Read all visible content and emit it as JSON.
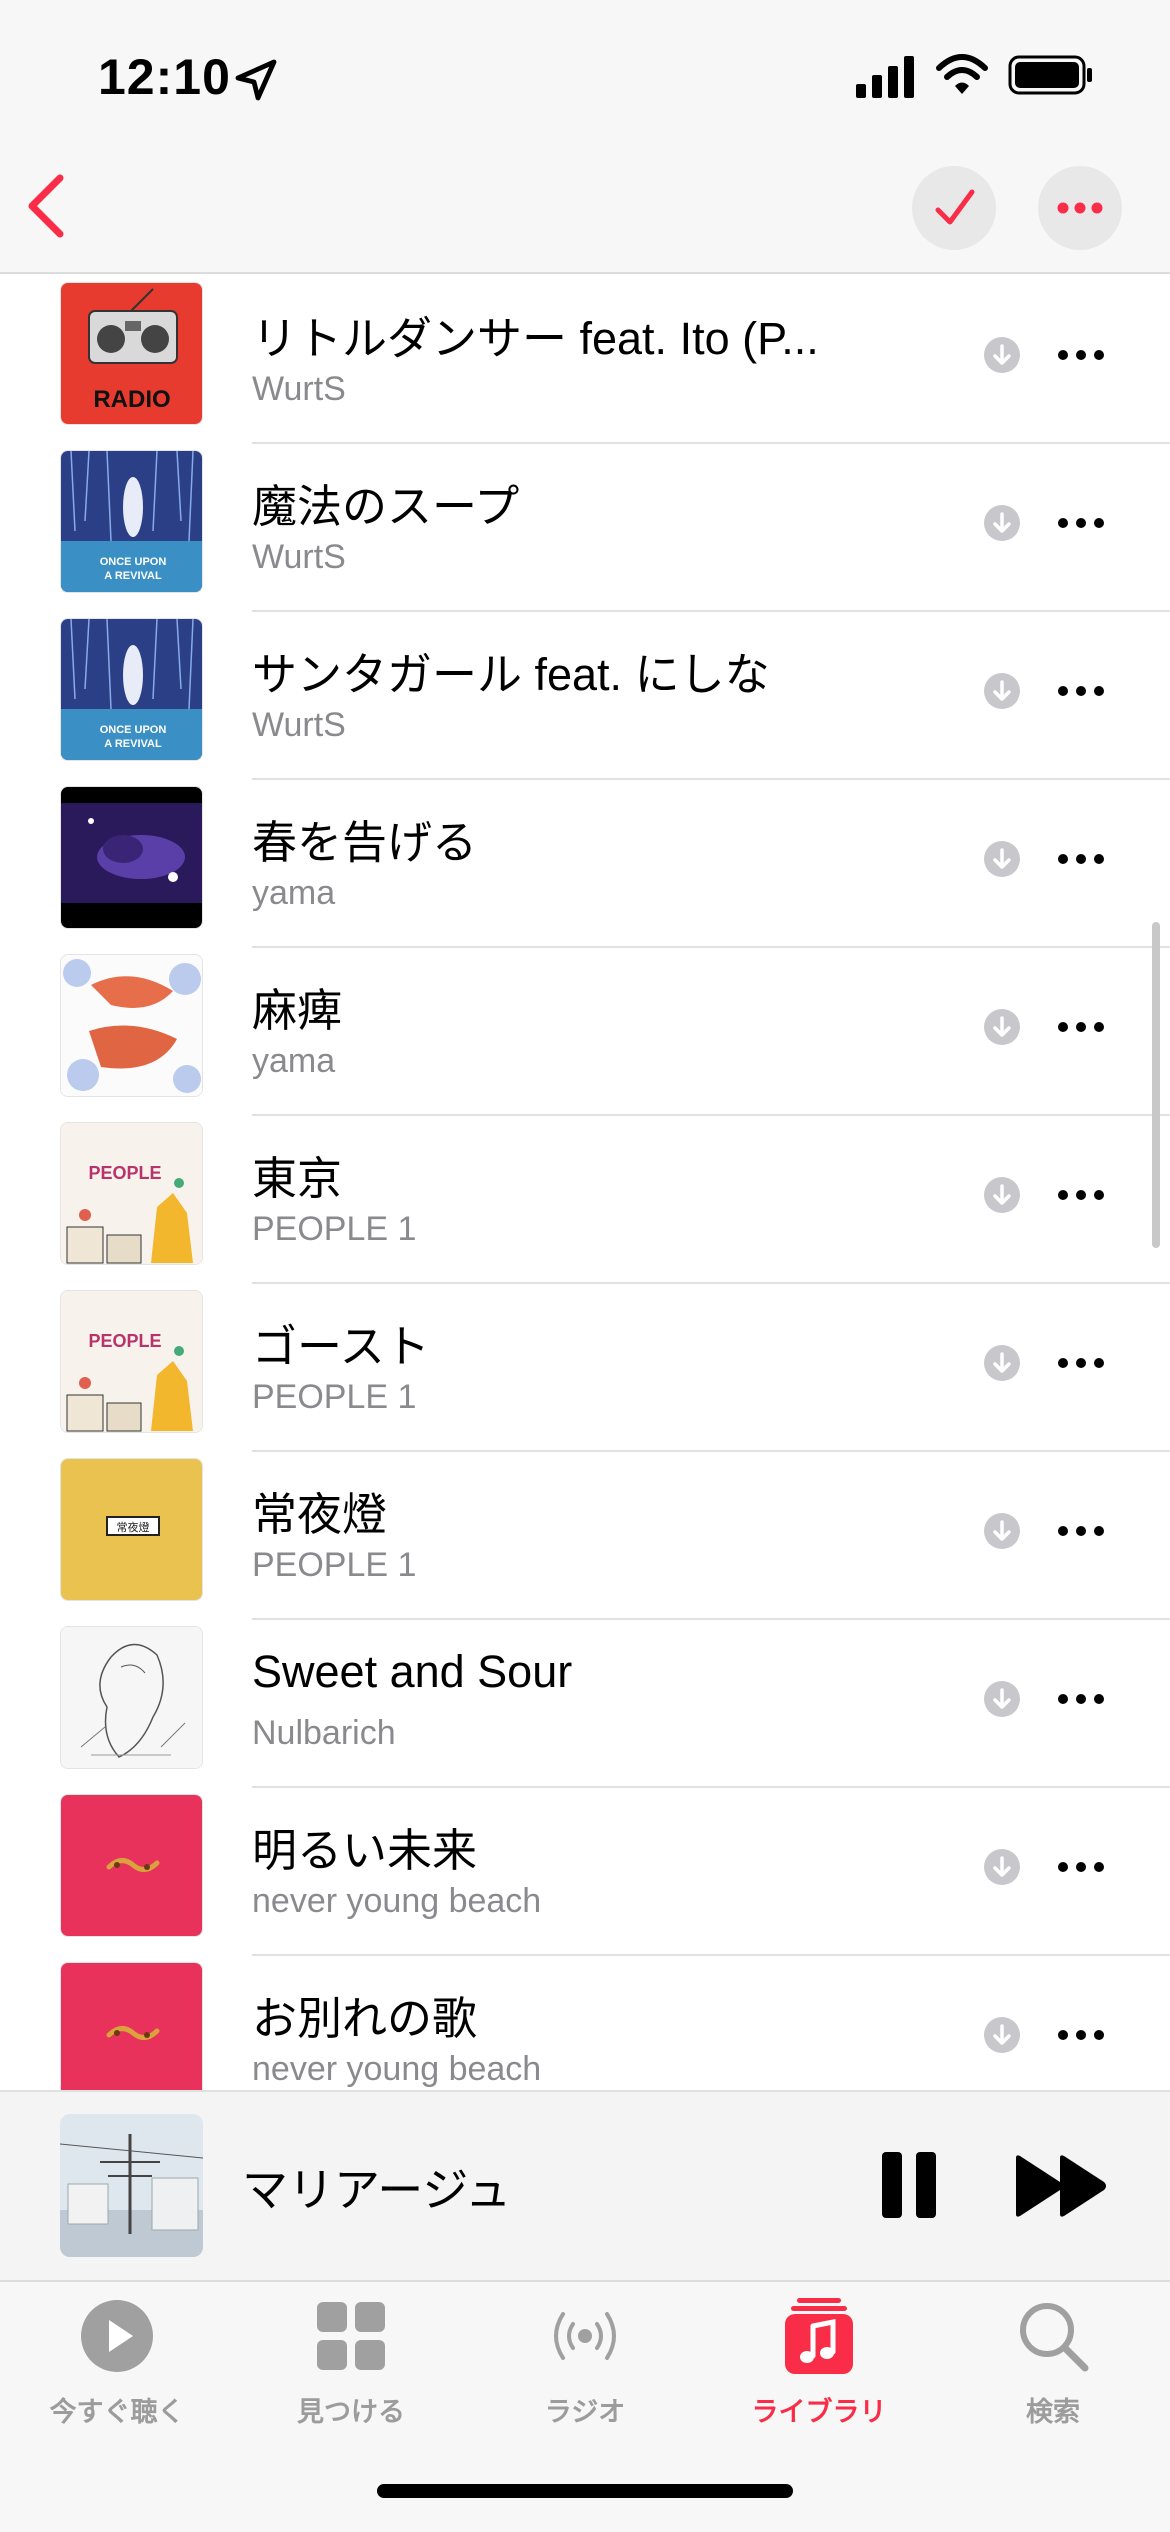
{
  "status_bar": {
    "time": "12:10"
  },
  "nav": {
    "back_icon": "chevron-left-icon",
    "check_icon": "checkmark-icon",
    "more_icon": "ellipsis-icon",
    "accent": "#fa2d48"
  },
  "songs": [
    {
      "title": "リトルダンサー feat. Ito (P...",
      "artist": "WurtS",
      "art": "radio"
    },
    {
      "title": "魔法のスープ",
      "artist": "WurtS",
      "art": "revival"
    },
    {
      "title": "サンタガール feat. にしな",
      "artist": "WurtS",
      "art": "revival"
    },
    {
      "title": "春を告げる",
      "artist": "yama",
      "art": "night"
    },
    {
      "title": "麻痺",
      "artist": "yama",
      "art": "mahi"
    },
    {
      "title": "東京",
      "artist": "PEOPLE 1",
      "art": "people"
    },
    {
      "title": "ゴースト",
      "artist": "PEOPLE 1",
      "art": "people"
    },
    {
      "title": "常夜燈",
      "artist": "PEOPLE 1",
      "art": "yellow"
    },
    {
      "title": "Sweet and Sour",
      "artist": "Nulbarich",
      "art": "sketch"
    },
    {
      "title": "明るい未来",
      "artist": "never young beach",
      "art": "pink"
    },
    {
      "title": "お別れの歌",
      "artist": "never young beach",
      "art": "pink"
    }
  ],
  "art_text": {
    "radio": "RADIO",
    "revival_line1": "ONCE UPON",
    "revival_line2": "A REVIVAL",
    "people": "PEOPLE",
    "yellow": "常夜燈"
  },
  "now_playing": {
    "title": "マリアージュ"
  },
  "tabs": [
    {
      "label": "今すぐ聴く",
      "icon": "play-circle-icon"
    },
    {
      "label": "見つける",
      "icon": "grid-icon"
    },
    {
      "label": "ラジオ",
      "icon": "radio-waves-icon"
    },
    {
      "label": "ライブラリ",
      "icon": "music-library-icon",
      "active": true
    },
    {
      "label": "検索",
      "icon": "search-icon"
    }
  ]
}
